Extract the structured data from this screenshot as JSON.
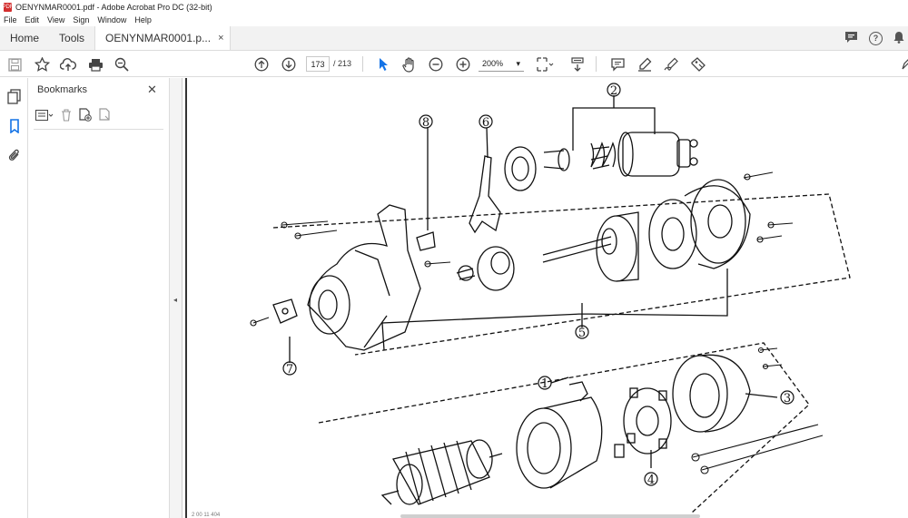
{
  "window": {
    "title": "OENYNMAR0001.pdf - Adobe Acrobat Pro DC (32-bit)",
    "pdf_badge": "PDF"
  },
  "menu": [
    "File",
    "Edit",
    "View",
    "Sign",
    "Window",
    "Help"
  ],
  "tabs": {
    "home": "Home",
    "tools": "Tools",
    "document": "OENYNMAR0001.p...",
    "close": "×"
  },
  "tab_icons": {
    "comment": "comment-icon",
    "help": "?",
    "bell": "bell-icon"
  },
  "toolbar": {
    "page_current": "173",
    "page_total": "/ 213",
    "zoom": "200%",
    "zoom_arrow": "▾"
  },
  "bookmarks": {
    "title": "Bookmarks",
    "close": "✕"
  },
  "collapse_arrow": "◂",
  "diagram": {
    "labels": [
      "2",
      "8",
      "6",
      "5",
      "7",
      "1",
      "3",
      "4"
    ]
  },
  "footer": "2 00 11 404",
  "colors": {
    "accent": "#1473e6",
    "pdf_red": "#d32f2f",
    "ink": "#111111"
  }
}
